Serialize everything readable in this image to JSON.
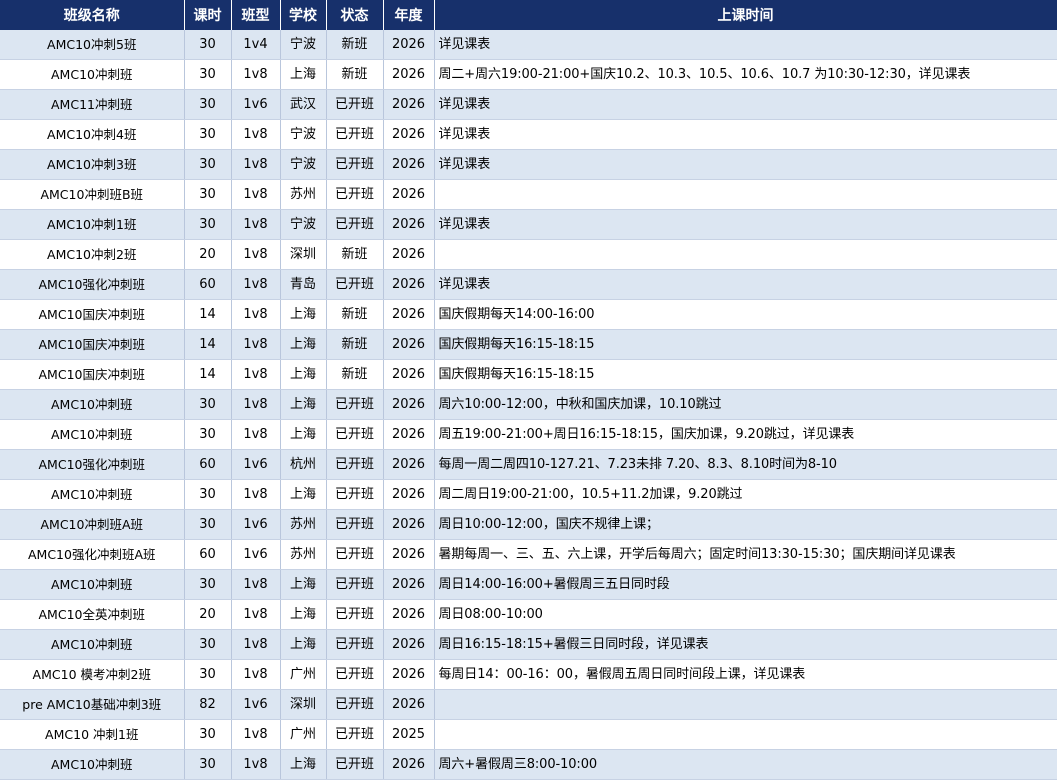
{
  "headers": [
    "班级名称",
    "课时",
    "班型",
    "学校",
    "状态",
    "年度",
    "上课时间"
  ],
  "rows": [
    {
      "name": "AMC10冲刺5班",
      "hours": "30",
      "type": "1v4",
      "school": "宁波",
      "status": "新班",
      "year": "2026",
      "time": "详见课表"
    },
    {
      "name": "AMC10冲刺班",
      "hours": "30",
      "type": "1v8",
      "school": "上海",
      "status": "新班",
      "year": "2026",
      "time": "周二+周六19:00-21:00+国庆10.2、10.3、10.5、10.6、10.7 为10:30-12:30，详见课表"
    },
    {
      "name": "AMC11冲刺班",
      "hours": "30",
      "type": "1v6",
      "school": "武汉",
      "status": "已开班",
      "year": "2026",
      "time": "详见课表"
    },
    {
      "name": "AMC10冲刺4班",
      "hours": "30",
      "type": "1v8",
      "school": "宁波",
      "status": "已开班",
      "year": "2026",
      "time": "详见课表"
    },
    {
      "name": "AMC10冲刺3班",
      "hours": "30",
      "type": "1v8",
      "school": "宁波",
      "status": "已开班",
      "year": "2026",
      "time": "详见课表"
    },
    {
      "name": "AMC10冲刺班B班",
      "hours": "30",
      "type": "1v8",
      "school": "苏州",
      "status": "已开班",
      "year": "2026",
      "time": ""
    },
    {
      "name": "AMC10冲刺1班",
      "hours": "30",
      "type": "1v8",
      "school": "宁波",
      "status": "已开班",
      "year": "2026",
      "time": "详见课表"
    },
    {
      "name": "AMC10冲刺2班",
      "hours": "20",
      "type": "1v8",
      "school": "深圳",
      "status": "新班",
      "year": "2026",
      "time": ""
    },
    {
      "name": "AMC10强化冲刺班",
      "hours": "60",
      "type": "1v8",
      "school": "青岛",
      "status": "已开班",
      "year": "2026",
      "time": "详见课表"
    },
    {
      "name": "AMC10国庆冲刺班",
      "hours": "14",
      "type": "1v8",
      "school": "上海",
      "status": "新班",
      "year": "2026",
      "time": "国庆假期每天14:00-16:00"
    },
    {
      "name": "AMC10国庆冲刺班",
      "hours": "14",
      "type": "1v8",
      "school": "上海",
      "status": "新班",
      "year": "2026",
      "time": "国庆假期每天16:15-18:15"
    },
    {
      "name": "AMC10国庆冲刺班",
      "hours": "14",
      "type": "1v8",
      "school": "上海",
      "status": "新班",
      "year": "2026",
      "time": "国庆假期每天16:15-18:15"
    },
    {
      "name": "AMC10冲刺班",
      "hours": "30",
      "type": "1v8",
      "school": "上海",
      "status": "已开班",
      "year": "2026",
      "time": "周六10:00-12:00，中秋和国庆加课，10.10跳过"
    },
    {
      "name": "AMC10冲刺班",
      "hours": "30",
      "type": "1v8",
      "school": "上海",
      "status": "已开班",
      "year": "2026",
      "time": "周五19:00-21:00+周日16:15-18:15，国庆加课，9.20跳过，详见课表"
    },
    {
      "name": "AMC10强化冲刺班",
      "hours": "60",
      "type": "1v6",
      "school": "杭州",
      "status": "已开班",
      "year": "2026",
      "time": "每周一周二周四10-127.21、7.23未排 7.20、8.3、8.10时间为8-10"
    },
    {
      "name": "AMC10冲刺班",
      "hours": "30",
      "type": "1v8",
      "school": "上海",
      "status": "已开班",
      "year": "2026",
      "time": "周二周日19:00-21:00，10.5+11.2加课，9.20跳过"
    },
    {
      "name": "AMC10冲刺班A班",
      "hours": "30",
      "type": "1v6",
      "school": "苏州",
      "status": "已开班",
      "year": "2026",
      "time": "周日10:00-12:00，国庆不规律上课；"
    },
    {
      "name": "AMC10强化冲刺班A班",
      "hours": "60",
      "type": "1v6",
      "school": "苏州",
      "status": "已开班",
      "year": "2026",
      "time": "暑期每周一、三、五、六上课，开学后每周六；固定时间13:30-15:30；国庆期间详见课表"
    },
    {
      "name": "AMC10冲刺班",
      "hours": "30",
      "type": "1v8",
      "school": "上海",
      "status": "已开班",
      "year": "2026",
      "time": "周日14:00-16:00+暑假周三五日同时段"
    },
    {
      "name": "AMC10全英冲刺班",
      "hours": "20",
      "type": "1v8",
      "school": "上海",
      "status": "已开班",
      "year": "2026",
      "time": "周日08:00-10:00"
    },
    {
      "name": "AMC10冲刺班",
      "hours": "30",
      "type": "1v8",
      "school": "上海",
      "status": "已开班",
      "year": "2026",
      "time": "周日16:15-18:15+暑假三日同时段，详见课表"
    },
    {
      "name": "AMC10 模考冲刺2班",
      "hours": "30",
      "type": "1v8",
      "school": "广州",
      "status": "已开班",
      "year": "2026",
      "time": "每周日14：00-16：00，暑假周五周日同时间段上课，详见课表"
    },
    {
      "name": "pre  AMC10基础冲刺3班",
      "hours": "82",
      "type": "1v6",
      "school": "深圳",
      "status": "已开班",
      "year": "2026",
      "time": ""
    },
    {
      "name": "AMC10 冲刺1班",
      "hours": "30",
      "type": "1v8",
      "school": "广州",
      "status": "已开班",
      "year": "2025",
      "time": ""
    },
    {
      "name": "AMC10冲刺班",
      "hours": "30",
      "type": "1v8",
      "school": "上海",
      "status": "已开班",
      "year": "2026",
      "time": "周六+暑假周三8:00-10:00"
    }
  ]
}
